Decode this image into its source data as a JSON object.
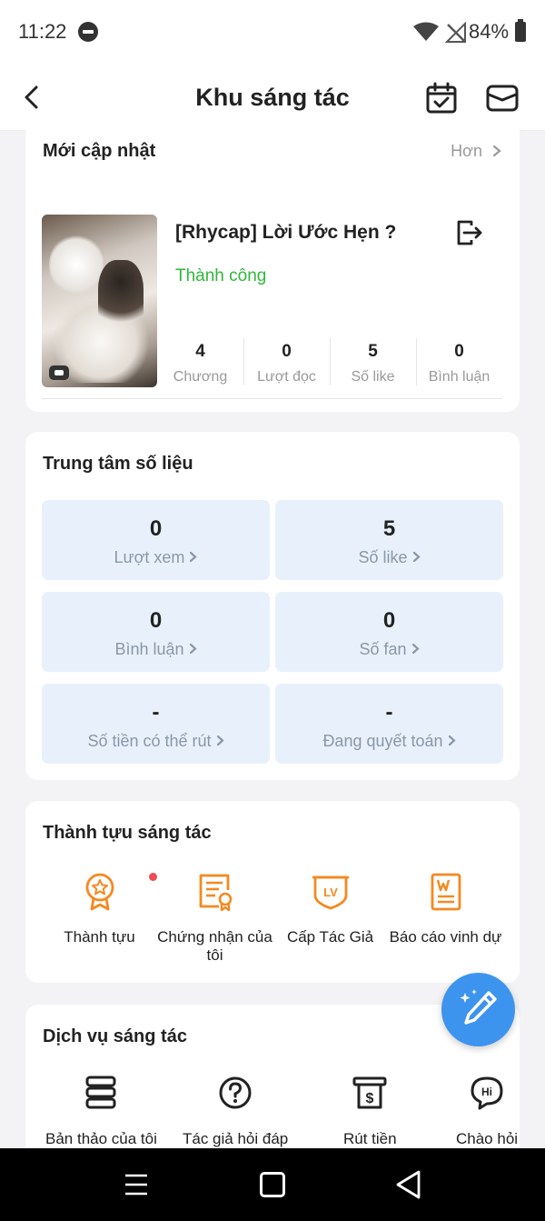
{
  "status_bar": {
    "time": "11:22",
    "battery": "84%"
  },
  "nav": {
    "title": "Khu sáng tác"
  },
  "recent": {
    "title": "Mới cập nhật",
    "more": "Hơn",
    "book": {
      "title": "[Rhycap] Lời Ước Hẹn ?",
      "status": "Thành công",
      "status_color": "#2fb83a",
      "stats": [
        {
          "value": "4",
          "label": "Chương"
        },
        {
          "value": "0",
          "label": "Lượt đọc"
        },
        {
          "value": "5",
          "label": "Số like"
        },
        {
          "value": "0",
          "label": "Bình luận"
        }
      ]
    }
  },
  "data_center": {
    "title": "Trung tâm số liệu",
    "metrics": [
      {
        "value": "0",
        "label": "Lượt xem"
      },
      {
        "value": "5",
        "label": "Số like"
      },
      {
        "value": "0",
        "label": "Bình luận"
      },
      {
        "value": "0",
        "label": "Số fan"
      },
      {
        "value": "-",
        "label": "Số tiền có thể rút"
      },
      {
        "value": "-",
        "label": "Đang quyết toán"
      }
    ]
  },
  "achievements": {
    "title": "Thành tựu sáng tác",
    "items": [
      {
        "label": "Thành tựu",
        "icon": "medal-icon"
      },
      {
        "label": "Chứng nhận của tôi",
        "icon": "certificate-icon"
      },
      {
        "label": "Cấp Tác Giả",
        "icon": "level-badge-icon"
      },
      {
        "label": "Báo cáo vinh dự",
        "icon": "honor-report-icon"
      }
    ],
    "accent_color": "#f5891f"
  },
  "services": {
    "title": "Dịch vụ sáng tác",
    "items": [
      {
        "label": "Bản thảo của tôi",
        "icon": "drafts-icon"
      },
      {
        "label": "Tác giả hỏi đáp",
        "icon": "question-icon"
      },
      {
        "label": "Rút tiền",
        "icon": "withdraw-icon"
      },
      {
        "label": "Chào hỏi",
        "icon": "greeting-icon"
      }
    ]
  },
  "fab": {
    "icon": "pen-sparkle-icon",
    "color": "#3d94ee"
  }
}
